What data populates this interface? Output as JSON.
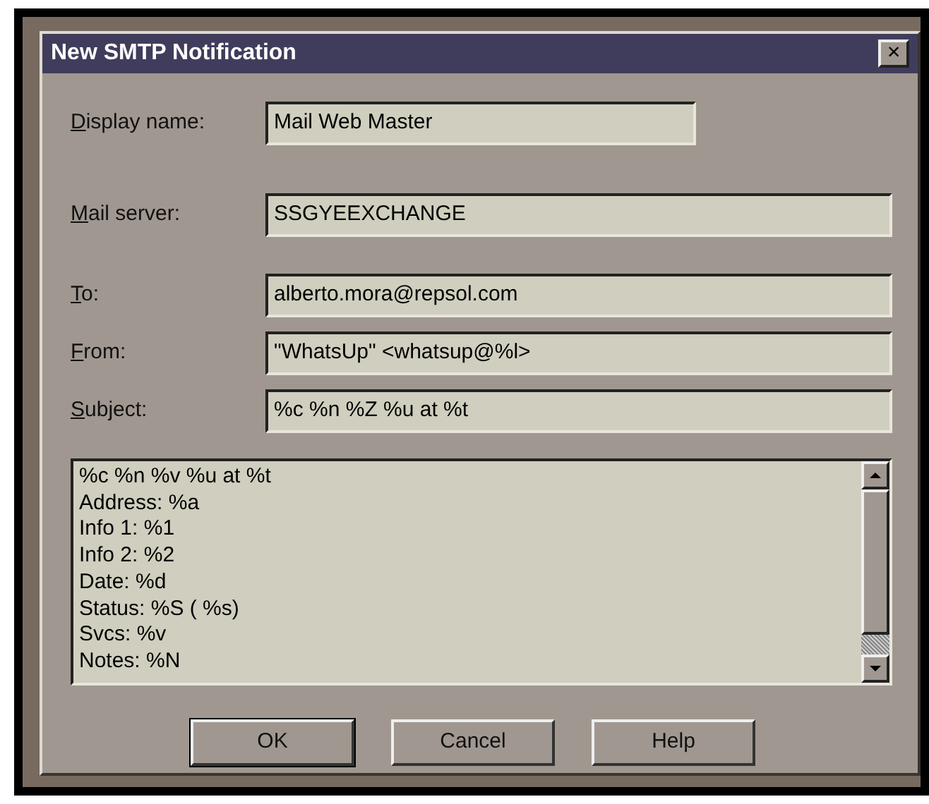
{
  "window": {
    "title": "New SMTP Notification",
    "close": "×"
  },
  "fields": [
    {
      "key": "D",
      "rest": "isplay name:",
      "value": "Mail Web Master",
      "kind": "narrow"
    },
    {
      "key": "M",
      "rest": "ail server:",
      "value": "SSGYEEXCHANGE",
      "kind": "wide"
    },
    {
      "key": "T",
      "rest": "o:",
      "value": "alberto.mora@repsol.com",
      "kind": "wide"
    },
    {
      "key": "F",
      "rest": "rom:",
      "value": "\"WhatsUp\" <whatsup@%l>",
      "kind": "wide"
    },
    {
      "key": "S",
      "rest": "ubject:",
      "value": "%c %n %Z %u at %t",
      "kind": "wide"
    }
  ],
  "message_lines": [
    "%c %n %v %u at %t",
    "Address: %a",
    "Info 1: %1",
    "Info 2: %2",
    "Date: %d",
    "Status: %S ( %s)",
    "Svcs: %v",
    "Notes: %N"
  ],
  "buttons": [
    {
      "label": "OK",
      "default": true
    },
    {
      "label": "Cancel",
      "default": false
    },
    {
      "label": "Help",
      "default": false
    }
  ]
}
